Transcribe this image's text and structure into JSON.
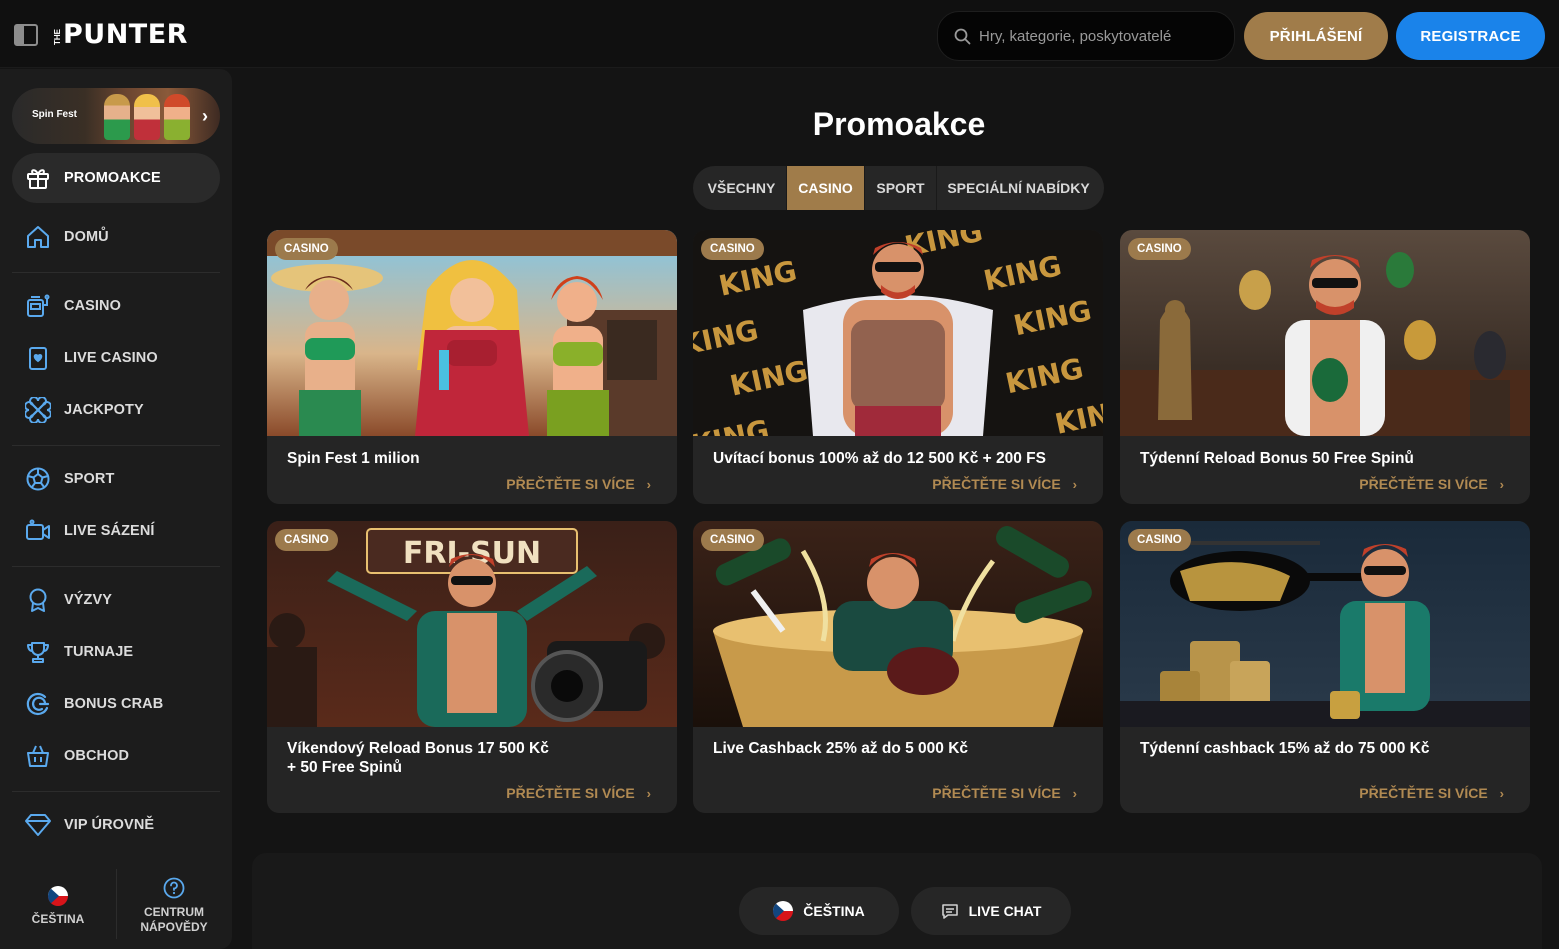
{
  "header": {
    "logo_prefix": "THE",
    "logo_word": "PUNTER",
    "search_placeholder": "Hry, kategorie, poskytovatelé",
    "login_label": "PŘIHLÁŠENÍ",
    "register_label": "REGISTRACE"
  },
  "colors": {
    "accent_gold": "#a07c4a",
    "accent_blue": "#1a83ea",
    "background": "#141414",
    "icon_blue": "#5aa9ee"
  },
  "sidebar": {
    "banner_label": "Spin Fest",
    "items": [
      {
        "label": "PROMOAKCE",
        "icon": "gift-icon",
        "active": true
      },
      {
        "label": "DOMŮ",
        "icon": "home-icon"
      },
      {
        "label": "CASINO",
        "icon": "slot-machine-icon"
      },
      {
        "label": "LIVE CASINO",
        "icon": "card-icon"
      },
      {
        "label": "JACKPOTY",
        "icon": "clover-icon"
      },
      {
        "label": "SPORT",
        "icon": "soccer-ball-icon"
      },
      {
        "label": "LIVE SÁZENÍ",
        "icon": "video-camera-icon"
      },
      {
        "label": "VÝZVY",
        "icon": "ribbon-icon"
      },
      {
        "label": "TURNAJE",
        "icon": "trophy-icon"
      },
      {
        "label": "BONUS CRAB",
        "icon": "bonus-crab-icon"
      },
      {
        "label": "OBCHOD",
        "icon": "shop-basket-icon"
      },
      {
        "label": "VIP ÚROVNĚ",
        "icon": "diamond-icon"
      }
    ],
    "language_label": "ČEŠTINA",
    "help_label_line1": "CENTRUM",
    "help_label_line2": "NÁPOVĚDY"
  },
  "main": {
    "title": "Promoakce",
    "tabs": [
      {
        "label": "VŠECHNY"
      },
      {
        "label": "CASINO",
        "active": true
      },
      {
        "label": "SPORT"
      },
      {
        "label": "SPECIÁLNÍ NABÍDKY"
      }
    ],
    "cards": [
      {
        "badge": "CASINO",
        "title": "Spin Fest 1 milion",
        "more": "PŘEČTĚTE SI VÍCE"
      },
      {
        "badge": "CASINO",
        "title": "Uvítací bonus 100% až do 12 500 Kč + 200 FS",
        "more": "PŘEČTĚTE SI VÍCE"
      },
      {
        "badge": "CASINO",
        "title": "Týdenní Reload Bonus 50 Free Spinů",
        "more": "PŘEČTĚTE SI VÍCE"
      },
      {
        "badge": "CASINO",
        "title_line1": "Víkendový Reload Bonus 17 500 Kč",
        "title_line2": "+ 50 Free Spinů",
        "more": "PŘEČTĚTE SI VÍCE"
      },
      {
        "badge": "CASINO",
        "title": "Live Cashback 25% až do 5 000 Kč",
        "more": "PŘEČTĚTE SI VÍCE"
      },
      {
        "badge": "CASINO",
        "title": "Týdenní cashback 15% až do 75 000 Kč",
        "more": "PŘEČTĚTE SI VÍCE"
      }
    ],
    "card_art_text": {
      "king": "KING",
      "fri_sun": "FRI-SUN"
    }
  },
  "footer": {
    "language_label": "ČEŠTINA",
    "chat_label": "LIVE CHAT"
  }
}
